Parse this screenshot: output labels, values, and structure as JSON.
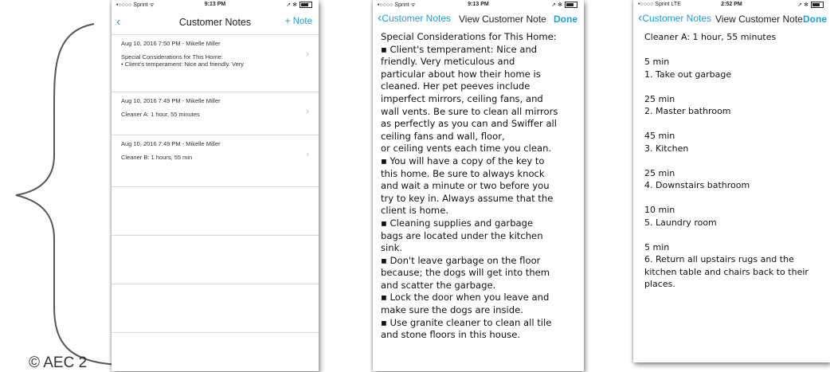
{
  "copyright": "© AEC 2",
  "screens": [
    {
      "status": {
        "carrier": "•○○○○ Sprint ᯤ",
        "time": "9:13 PM",
        "right": "➚ ✻"
      },
      "nav": {
        "back": "‹",
        "title": "Customer Notes",
        "action": "+ Note"
      },
      "notes": [
        {
          "meta": "Aug 10, 2016 7:50 PM - Mikelle Miller",
          "line1": "Special Considerations for This Home:",
          "line2": "•     Client's temperament: Nice and friendly. Very"
        },
        {
          "meta": "Aug 10, 2016 7:49 PM - Mikelle Miller",
          "line1": "Cleaner A: 1 hour, 55 minutes",
          "line2": ""
        },
        {
          "meta": "Aug 10, 2016 7:49 PM - Mikelle Miller",
          "line1": "Cleaner B:  1 hours, 55 min",
          "line2": ""
        }
      ]
    },
    {
      "status": {
        "carrier": "•○○○○ Sprint ᯤ",
        "time": "9:13 PM",
        "right": "➚ ✻"
      },
      "nav": {
        "back": "Customer Notes",
        "title": "View Customer Note",
        "action": "Done"
      },
      "lines": [
        "Special Considerations for This Home:",
        "▪   Client's temperament: Nice and",
        "friendly. Very meticulous and",
        "particular about how their home is",
        "cleaned. Her pet peeves include",
        "imperfect mirrors, ceiling fans, and",
        "wall vents. Be sure to clean all mirrors",
        "as perfectly as you can and Swiffer all",
        "ceiling fans and wall, floor,",
        "or ceiling vents each time you clean.",
        "▪   You will have a copy of the key to",
        "this home. Be sure to always knock",
        "and wait a minute or two before you",
        "try to key in. Always assume that the",
        "client is home.",
        "▪   Cleaning supplies and garbage",
        "bags are located under the kitchen",
        "sink.",
        "▪   Don't leave garbage on the floor",
        "because; the dogs will get into them",
        "and scatter the garbage.",
        "▪   Lock the door when you leave and",
        "make sure the dogs are inside.",
        "▪   Use granite cleaner to clean all tile",
        "and stone floors in this house."
      ]
    },
    {
      "status": {
        "carrier": "•○○○○ Sprint  LTE",
        "time": "2:52 PM",
        "right": "➚ ✻"
      },
      "nav": {
        "back": "Customer Notes",
        "title": "View Customer Note",
        "action": "Done"
      },
      "header": "Cleaner A: 1 hour, 55 minutes",
      "steps": [
        {
          "time": "5 min",
          "lines": [
            "1. Take out garbage"
          ]
        },
        {
          "time": "25 min",
          "lines": [
            "2. Master bathroom"
          ]
        },
        {
          "time": "45 min",
          "lines": [
            "3. Kitchen"
          ]
        },
        {
          "time": "25 min",
          "lines": [
            "4. Downstairs bathroom"
          ]
        },
        {
          "time": "10 min",
          "lines": [
            "5. Laundry room"
          ]
        },
        {
          "time": "5 min",
          "lines": [
            "6. Return all upstairs rugs and the",
            "kitchen table and chairs back to their",
            "places."
          ]
        }
      ]
    }
  ],
  "colors": {
    "accent": "#1a9fe0",
    "text": "#222222",
    "divider": "#d8d8d8"
  }
}
